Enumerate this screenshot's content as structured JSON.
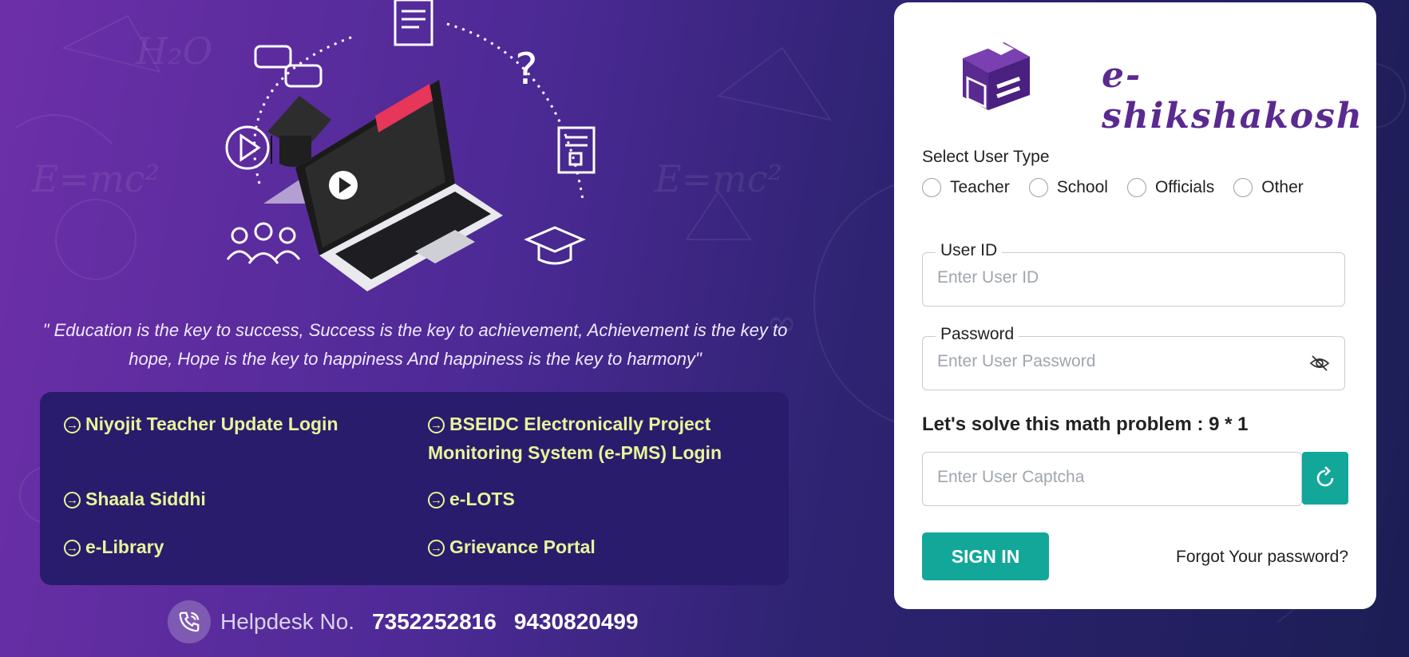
{
  "brand": {
    "name": "e-shikshakosh"
  },
  "quote": "\" Education is the key to success, Success is the key to achievement, Achievement is the key to hope, Hope is the key to happiness And happiness is the key to harmony\"",
  "quick_links": [
    {
      "label": "Niyojit Teacher Update Login"
    },
    {
      "label": "BSEIDC Electronically Project Monitoring System (e-PMS) Login"
    },
    {
      "label": "Shaala Siddhi"
    },
    {
      "label": "e-LOTS"
    },
    {
      "label": "e-Library"
    },
    {
      "label": "Grievance Portal"
    }
  ],
  "helpdesk": {
    "label": "Helpdesk No.",
    "numbers": [
      "7352252816",
      "9430820499"
    ]
  },
  "login": {
    "user_type_label": "Select User Type",
    "user_types": [
      "Teacher",
      "School",
      "Officials",
      "Other"
    ],
    "user_id": {
      "label": "User ID",
      "placeholder": "Enter User ID"
    },
    "password": {
      "label": "Password",
      "placeholder": "Enter User Password"
    },
    "math_prompt": "Let's solve this math problem : 9 * 1",
    "captcha": {
      "placeholder": "Enter User Captcha"
    },
    "sign_in_label": "SIGN IN",
    "forgot_label": "Forgot Your password?"
  },
  "colors": {
    "accent": "#13a79a",
    "link": "#e8f59a",
    "brand_purple": "#5a2a90",
    "panel": "#2a1c6c"
  },
  "icons": [
    "arrow-right-circle-icon",
    "phone-icon",
    "eye-slash-icon",
    "refresh-icon",
    "laptop-illustration",
    "graduation-cap-icon",
    "play-icon",
    "question-icon",
    "document-icon",
    "chat-icon",
    "users-icon"
  ]
}
